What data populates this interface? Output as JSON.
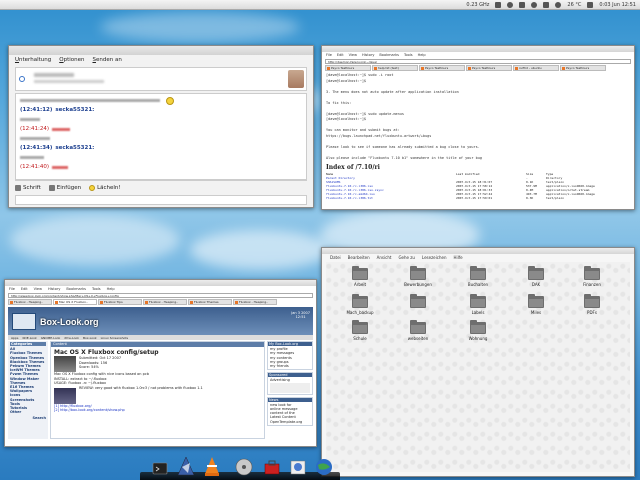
{
  "tray": {
    "cpu": "0.23 GHz",
    "temperature": "26 °C",
    "clock": "0:03 Jun 12:51"
  },
  "chat": {
    "menu": [
      "Unterhaltung",
      "Optionen",
      "Senden an"
    ],
    "messages": [
      {
        "time": "(12:41:12)",
        "name": "secka55321:",
        "kind": "blue"
      },
      {
        "time": "(12:41:24)",
        "name": "",
        "kind": "red"
      },
      {
        "time": "(12:41:34)",
        "name": "secka55321:",
        "kind": "blue"
      },
      {
        "time": "(12:41:40)",
        "name": "",
        "kind": "red"
      }
    ],
    "toolbar": {
      "font": "Schrift",
      "insert": "Einfügen",
      "smile": "Lächeln!"
    }
  },
  "term": {
    "menu": [
      "File",
      "Edit",
      "View",
      "History",
      "Bookmarks",
      "Tools",
      "Help"
    ],
    "url": "http://daemon.fazery.org/~dave/",
    "tabs": [
      "Psyco Testtours",
      "help.txt (text)",
      "Psyco Testtours",
      "Psyco Testtours",
      "rsrfhd - ubuntu",
      "Psyco Testtours",
      "Psyco Testtours"
    ],
    "lines": [
      "[dave@localhost:~]$ sudo -i root",
      "[dave@localhost:~]$",
      "",
      "3. The menu does not auto update after application installation",
      "",
      "To fix this:",
      "",
      "[dave@localhost:~]$ sudo update-menus",
      "[dave@localhost:~]$",
      "",
      "You can monitor and submit bugs at:",
      "https://bugs.launchpad.net/fluxbuntu-artwork/+bugs",
      "",
      "Please look to see if someone has already submitted a bug close to yours.",
      "",
      "Also please include \"Fluxbuntu 7.10 b1\" somewhere in the title of your bug"
    ],
    "index_title": "Index of /7.10/ri",
    "table_header": [
      "Name",
      "Last modified",
      "Size",
      "Type"
    ],
    "table_rows": [
      [
        "Parent Directory",
        "",
        "-",
        "Directory"
      ],
      [
        "SHA1SUMS",
        "2007-Oct-15 18:31:07",
        "0.1K",
        "text/plain"
      ],
      [
        "fluxbuntu-7.10-rc-i386.iso",
        "2007-Oct-15 17:58:12",
        "537.9M",
        "application/x-iso9660-image"
      ],
      [
        "fluxbuntu-7.10-rc-i386.iso.zsync",
        "2007-Oct-15 18:01:33",
        "0.4M",
        "application/octet-stream"
      ],
      [
        "fluxbuntu-7.10-rc-amd64.iso",
        "2007-Oct-15 17:52:44",
        "493.7M",
        "application/x-iso9660-image"
      ],
      [
        "fluxbuntu-7.10-rc-i386.txt",
        "2007-Oct-15 17:59:01",
        "0.3K",
        "text/plain"
      ]
    ]
  },
  "browser": {
    "menu": [
      "File",
      "Edit",
      "View",
      "History",
      "Bookmarks",
      "Tools",
      "Help"
    ],
    "url": "http://www.box-look.org/content/show.php/Mac+OS+X+Fluxbox+config",
    "tabs": [
      "Fluxbox - Heaping..",
      "Mac OS X Fluxbox..",
      "Fluxbox Tips",
      "Fluxbox - Heaping..",
      "Fluxbox Themes",
      "Fluxbox - Heaping.."
    ],
    "logo": "Box-Look.org",
    "date": "Jan 3 2007\n12:51",
    "nav": [
      "Apps",
      "KDE-Look",
      "GNOME-Look",
      "Xfce-Look",
      "Box-Look",
      "Linux Screenshots"
    ],
    "left_header": "Categories",
    "left_items": [
      "All",
      "Fluxbox Themes",
      "Openbox Themes",
      "Blackbox Themes",
      "Pekwm Themes",
      "IceWM Themes",
      "Fvwm Themes",
      "Window Maker Themes",
      "E16 Themes",
      "Wallpapers",
      "Icons",
      "Screenshots",
      "Tools",
      "Tutorials",
      "Other"
    ],
    "search_label": "Search",
    "content_tab": "Content",
    "post_title": "Mac OS X Fluxbox config/setup",
    "post_meta": [
      "Submitted: Oct 17 2007",
      "Downloads: 156",
      "Score: 54%"
    ],
    "post_lines": [
      "Mac OS X Fluxbox config with nice icons based on pcb",
      "INSTALL: extract to ~/.fluxbox",
      "USAGE: fluxbox -rc ~/.fluxbox",
      "",
      "REVIEW: very good with fluxbox 1.0rc3 / not problems with fluxbox 1.1",
      "",
      "[1] http://fluxbox.org/",
      "[2] http://box-look.org/content/show.php"
    ],
    "right_boxes": [
      {
        "title": "My Box-Look.org",
        "items": [
          "my profile",
          "my messages",
          "my contents",
          "my groups",
          "my friends"
        ]
      },
      {
        "title": "Sponsored",
        "items": [
          "Advertising"
        ]
      },
      {
        "title": "News",
        "items": [
          "new look for",
          "online message",
          "content of the",
          "Latest Content",
          "OpenTemplate.org"
        ]
      }
    ]
  },
  "fm": {
    "menu": [
      "Datei",
      "Bearbeiten",
      "Ansicht",
      "Gehe zu",
      "Lesezeichen",
      "Hilfe"
    ],
    "folders": [
      "Arbeit",
      "Bewerbungen",
      "Buchalten",
      "DAK",
      "Finanzen",
      "Mach_backup",
      "",
      "Labels",
      "Miles",
      "PDFs",
      "Schule",
      "webseiten",
      "Wohnung"
    ]
  }
}
